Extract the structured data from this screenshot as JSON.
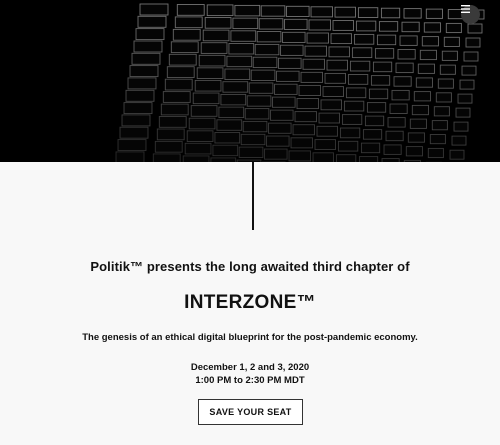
{
  "hero": {
    "menu_icon": "hamburger-menu-icon",
    "image_description": "dark-building-facade"
  },
  "content": {
    "intro": "Politik™ presents the long awaited third chapter of",
    "title": "INTERZONE™",
    "tagline": "The genesis of an ethical digital blueprint for the post-pandemic economy.",
    "dates_line": "December 1, 2 and 3, 2020",
    "time_line": "1:00 PM to 2:30 PM MDT",
    "cta_label": "SAVE YOUR SEAT"
  },
  "colors": {
    "background": "#f8f8f8",
    "hero": "#000000",
    "text": "#111111"
  }
}
